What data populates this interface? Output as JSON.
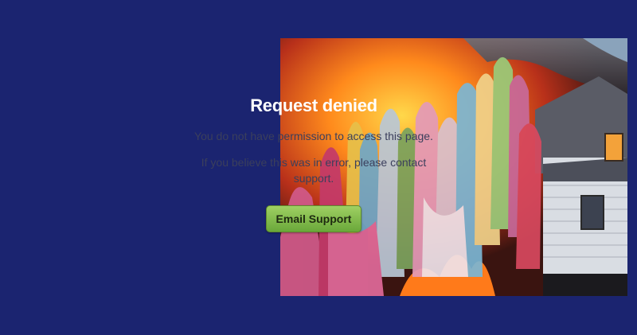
{
  "page": {
    "title": "Request denied",
    "message": "You do not have permission to access this page.",
    "detail": "If you believe this was in error, please contact support.",
    "button_label": "Email Support"
  },
  "colors": {
    "background": "#1b2470",
    "title": "#ffffff",
    "body_text": "#3b3f5c",
    "button": "#7fb84a"
  },
  "artwork": {
    "name": "burning-house-paint-streaks-image"
  }
}
